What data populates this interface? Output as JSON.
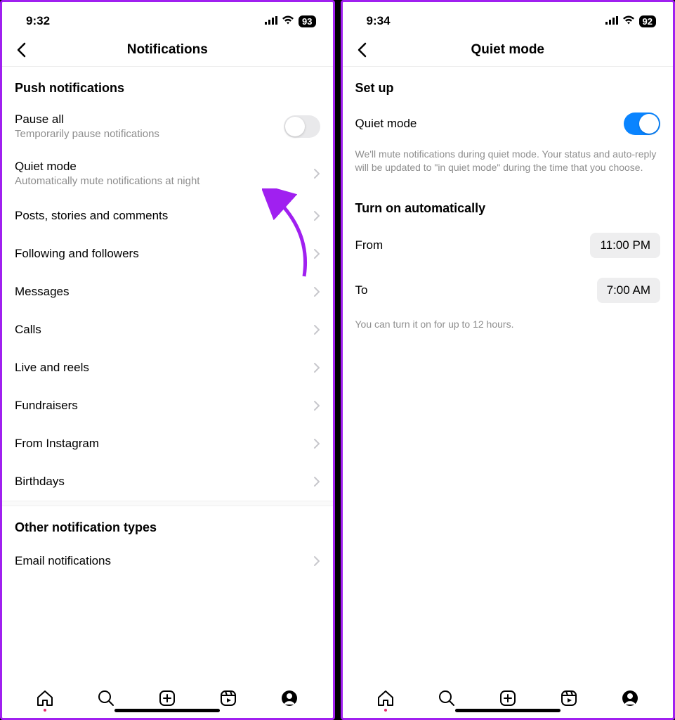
{
  "left": {
    "status": {
      "time": "9:32",
      "battery": "93"
    },
    "nav_title": "Notifications",
    "section1_header": "Push notifications",
    "pause_all": {
      "title": "Pause all",
      "sub": "Temporarily pause notifications"
    },
    "quiet_mode": {
      "title": "Quiet mode",
      "sub": "Automatically mute notifications at night"
    },
    "items": [
      "Posts, stories and comments",
      "Following and followers",
      "Messages",
      "Calls",
      "Live and reels",
      "Fundraisers",
      "From Instagram",
      "Birthdays"
    ],
    "section2_header": "Other notification types",
    "section2_items": [
      "Email notifications"
    ]
  },
  "right": {
    "status": {
      "time": "9:34",
      "battery": "92"
    },
    "nav_title": "Quiet mode",
    "setup_header": "Set up",
    "quiet_mode_label": "Quiet mode",
    "quiet_mode_desc": "We'll mute notifications during quiet mode. Your status and auto-reply will be updated to \"in quiet mode\" during the time that you choose.",
    "auto_header": "Turn on automatically",
    "from_label": "From",
    "from_time": "11:00 PM",
    "to_label": "To",
    "to_time": "7:00 AM",
    "footnote": "You can turn it on for up to 12 hours."
  }
}
